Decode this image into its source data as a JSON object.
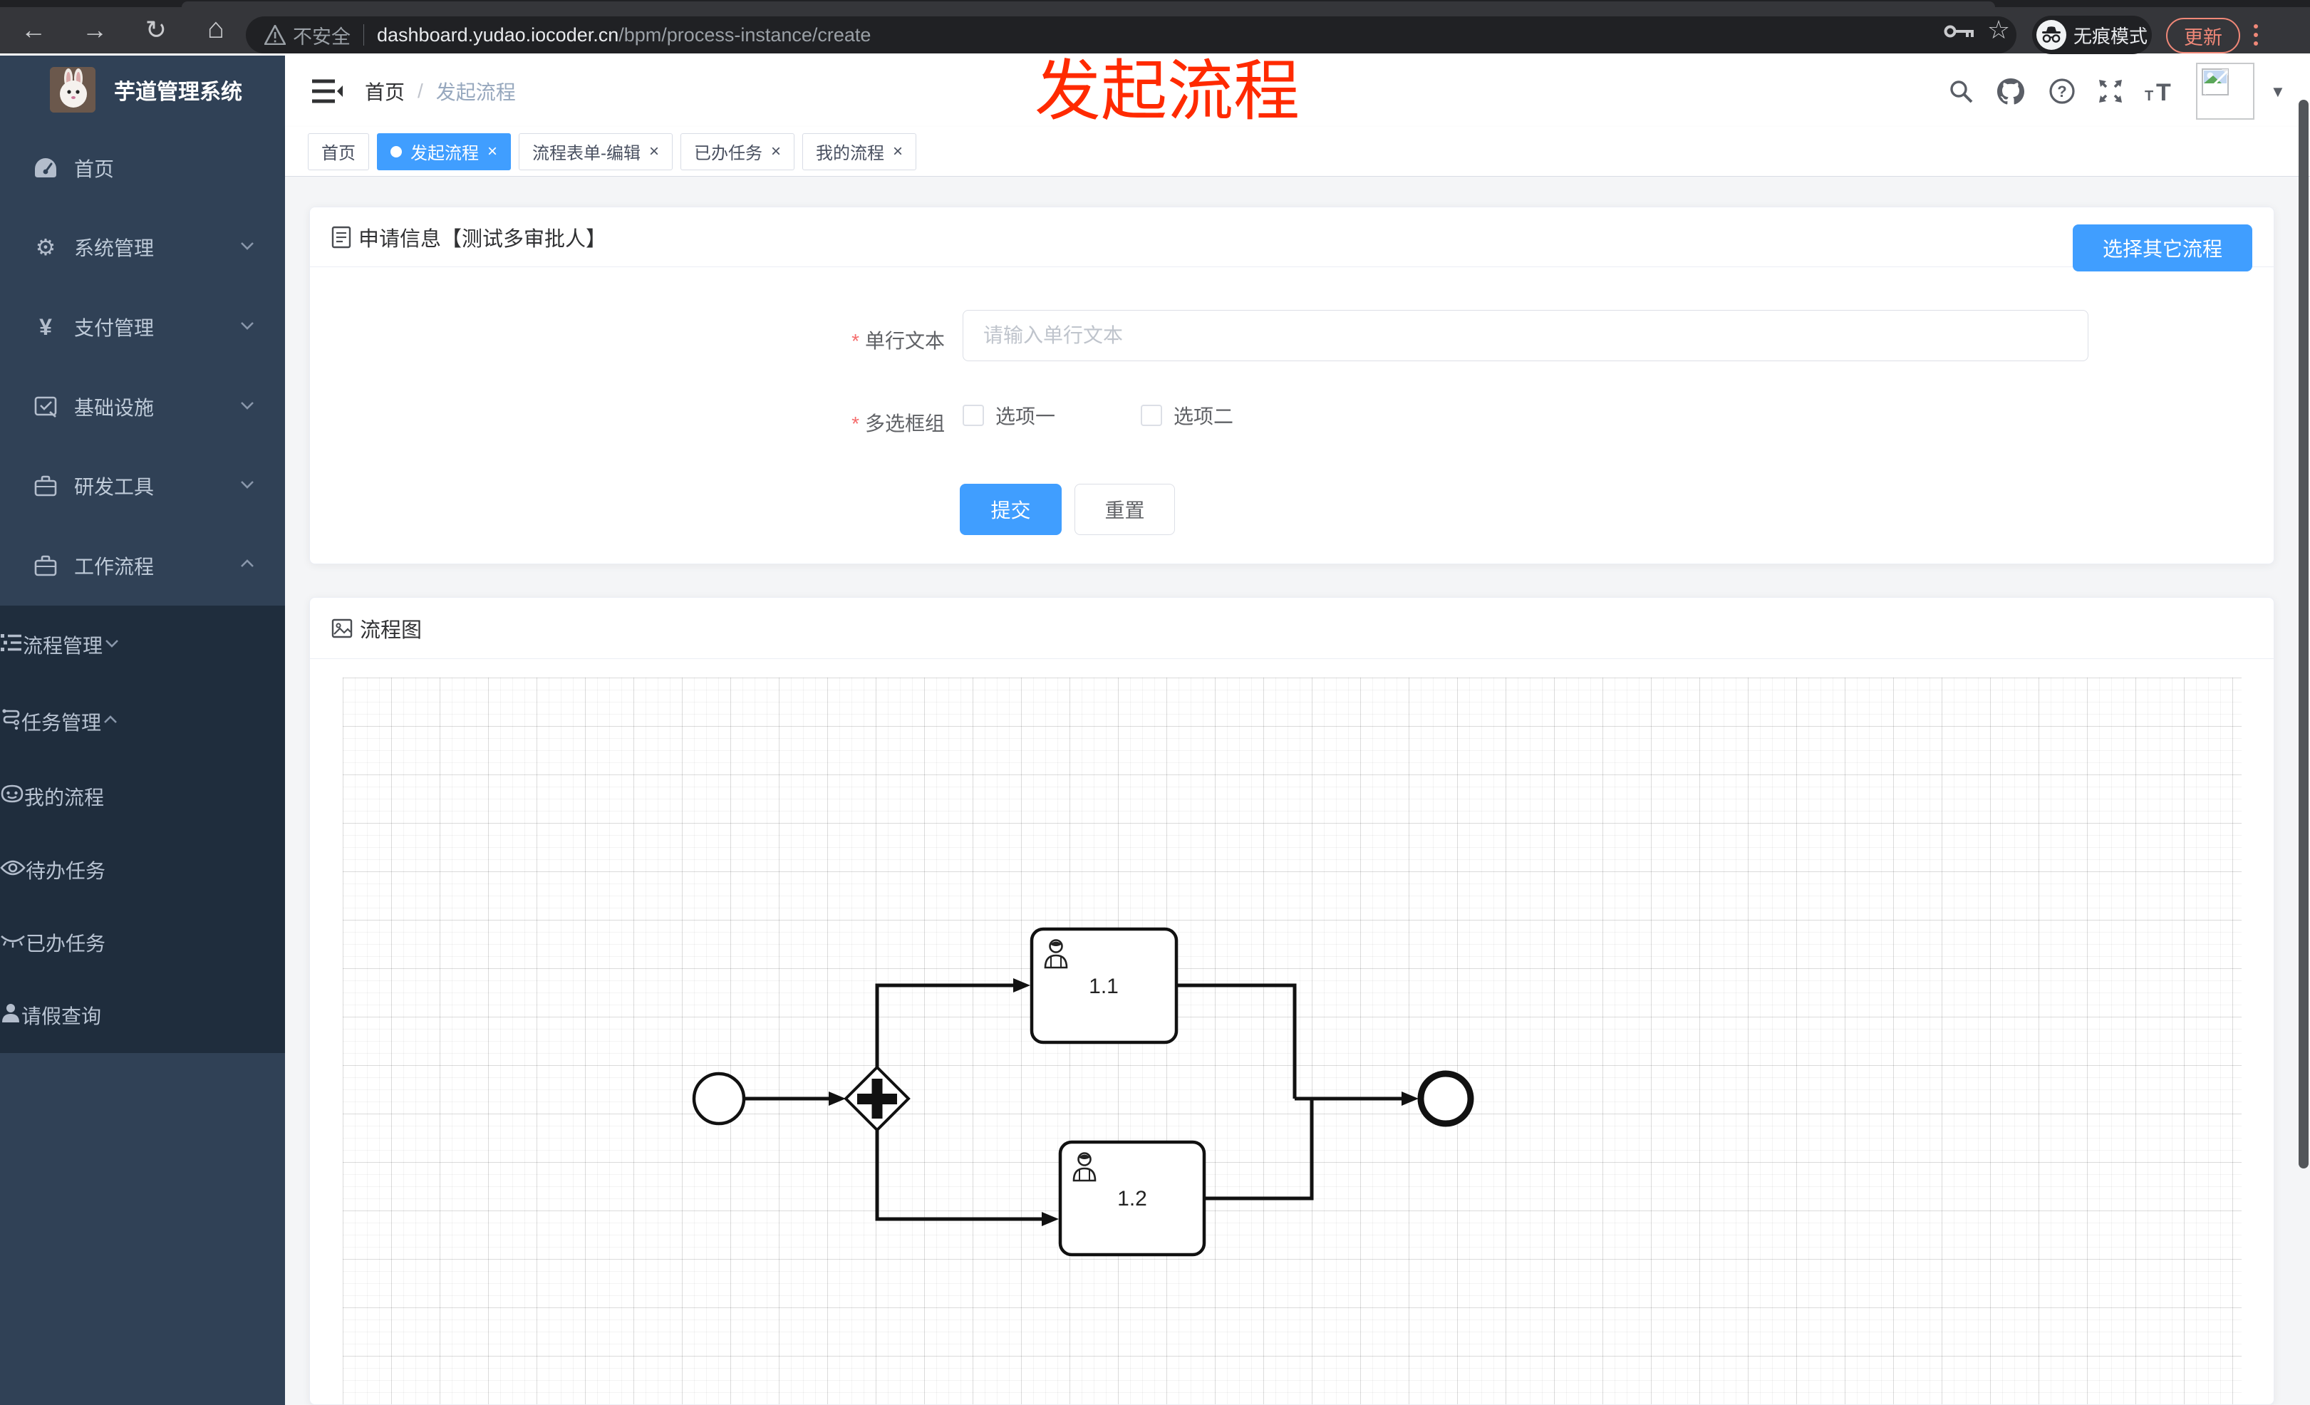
{
  "colors": {
    "primary": "#409eff",
    "danger": "#f56c6c",
    "annotation_red": "#ff2a00",
    "sidebar_bg": "#304156",
    "submenu_bg": "#1f2d3d"
  },
  "annotation": {
    "title": "发起流程"
  },
  "browser": {
    "security_label": "不安全",
    "url_host": "dashboard.yudao.iocoder.cn",
    "url_path": "/bpm/process-instance/create",
    "incognito_label": "无痕模式",
    "update_label": "更新"
  },
  "sidebar": {
    "app_title": "芋道管理系统",
    "items": [
      {
        "label": "首页",
        "icon": "dashboard-icon",
        "level": 1
      },
      {
        "label": "系统管理",
        "icon": "gear-icon",
        "level": 1,
        "expand": "down"
      },
      {
        "label": "支付管理",
        "icon": "yen-icon",
        "level": 1,
        "expand": "down"
      },
      {
        "label": "基础设施",
        "icon": "infra-icon",
        "level": 1,
        "expand": "down"
      },
      {
        "label": "研发工具",
        "icon": "toolbox-icon",
        "level": 1,
        "expand": "down"
      },
      {
        "label": "工作流程",
        "icon": "toolbox-icon",
        "level": 1,
        "expand": "up"
      },
      {
        "label": "流程管理",
        "icon": "process-list-icon",
        "level": 2,
        "expand": "down"
      },
      {
        "label": "任务管理",
        "icon": "task-branch-icon",
        "level": 2,
        "expand": "up"
      },
      {
        "label": "我的流程",
        "icon": "face-icon",
        "level": 3
      },
      {
        "label": "待办任务",
        "icon": "eye-icon",
        "level": 3
      },
      {
        "label": "已办任务",
        "icon": "eye-closed-icon",
        "level": 3
      },
      {
        "label": "请假查询",
        "icon": "user-icon",
        "level": 2
      }
    ]
  },
  "navbar": {
    "breadcrumb_home": "首页",
    "breadcrumb_separator": "/",
    "breadcrumb_current": "发起流程"
  },
  "tags_view": {
    "close_glyph": "×",
    "tags": [
      {
        "label": "首页",
        "active": false,
        "closable": false
      },
      {
        "label": "发起流程",
        "active": true,
        "closable": true
      },
      {
        "label": "流程表单-编辑",
        "active": false,
        "closable": true
      },
      {
        "label": "已办任务",
        "active": false,
        "closable": true
      },
      {
        "label": "我的流程",
        "active": false,
        "closable": true
      }
    ]
  },
  "form_card": {
    "title": "申请信息【测试多审批人】",
    "choose_other_label": "选择其它流程",
    "required_mark": "*",
    "field_text": {
      "label": "单行文本",
      "placeholder": "请输入单行文本"
    },
    "field_checkbox": {
      "label": "多选框组",
      "options": [
        "选项一",
        "选项二"
      ]
    },
    "submit_label": "提交",
    "reset_label": "重置"
  },
  "diagram_card": {
    "title": "流程图",
    "task1_label": "1.1",
    "task2_label": "1.2",
    "nodes": [
      "start-event",
      "parallel-gateway",
      "user-task-1.1",
      "user-task-1.2",
      "end-event"
    ]
  }
}
